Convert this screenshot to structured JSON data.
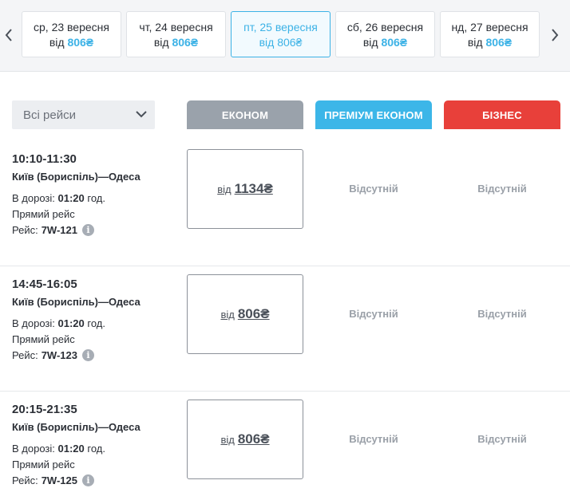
{
  "dates": [
    {
      "day": "ср, 23 вересня",
      "from": "від",
      "price": "806₴"
    },
    {
      "day": "чт, 24 вересня",
      "from": "від",
      "price": "806₴"
    },
    {
      "day": "пт, 25 вересня",
      "from": "від",
      "price": "806₴"
    },
    {
      "day": "сб, 26 вересня",
      "from": "від",
      "price": "806₴"
    },
    {
      "day": "нд, 27 вересня",
      "from": "від",
      "price": "806₴"
    }
  ],
  "filter": {
    "label": "Всі рейси"
  },
  "classes": {
    "econom": "ЕКОНОМ",
    "premium": "ПРЕМІУМ ЕКОНОМ",
    "business": "БІЗНЕС"
  },
  "colors": {
    "accent": "#3cb6e8",
    "econom": "#9aa2ab",
    "business": "#e8403a"
  },
  "flights": [
    {
      "time": "10:10-11:30",
      "route": "Київ (Бориспіль)—Одеса",
      "duration_label": "В дорозі:",
      "duration": "01:20",
      "duration_unit": "год.",
      "direct": "Прямий рейс",
      "flight_label": "Рейс:",
      "flight_no": "7W-121",
      "econom_from": "від",
      "econom_price": "1134₴",
      "premium": "Відсутній",
      "business": "Відсутній"
    },
    {
      "time": "14:45-16:05",
      "route": "Київ (Бориспіль)—Одеса",
      "duration_label": "В дорозі:",
      "duration": "01:20",
      "duration_unit": "год.",
      "direct": "Прямий рейс",
      "flight_label": "Рейс:",
      "flight_no": "7W-123",
      "econom_from": "від",
      "econom_price": "806₴",
      "premium": "Відсутній",
      "business": "Відсутній"
    },
    {
      "time": "20:15-21:35",
      "route": "Київ (Бориспіль)—Одеса",
      "duration_label": "В дорозі:",
      "duration": "01:20",
      "duration_unit": "год.",
      "direct": "Прямий рейс",
      "flight_label": "Рейс:",
      "flight_no": "7W-125",
      "econom_from": "від",
      "econom_price": "806₴",
      "premium": "Відсутній",
      "business": "Відсутній"
    }
  ]
}
